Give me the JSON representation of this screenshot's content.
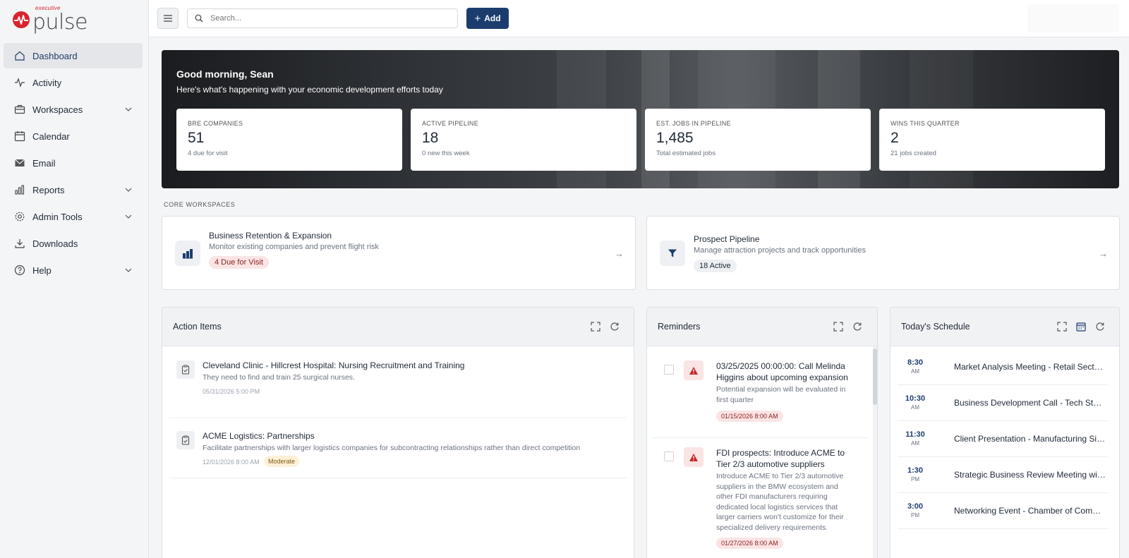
{
  "brand": {
    "small": "executive",
    "big": "pulse",
    "accent": "#d9232d"
  },
  "sidebar": {
    "items": [
      {
        "label": "Dashboard",
        "icon": "home-icon",
        "active": true
      },
      {
        "label": "Activity",
        "icon": "activity-icon"
      },
      {
        "label": "Workspaces",
        "icon": "briefcase-icon",
        "expandable": true
      },
      {
        "label": "Calendar",
        "icon": "calendar-icon"
      },
      {
        "label": "Email",
        "icon": "mail-icon"
      },
      {
        "label": "Reports",
        "icon": "bar-chart-icon",
        "expandable": true
      },
      {
        "label": "Admin Tools",
        "icon": "gear-icon",
        "expandable": true
      },
      {
        "label": "Downloads",
        "icon": "download-icon"
      },
      {
        "label": "Help",
        "icon": "help-icon",
        "expandable": true
      }
    ]
  },
  "topbar": {
    "search_placeholder": "Search...",
    "add_label": "Add",
    "accent": "#1b3d6e"
  },
  "hero": {
    "greeting": "Good morning, Sean",
    "subtitle": "Here's what's happening with your economic development efforts today",
    "stats": [
      {
        "label": "BRE COMPANIES",
        "value": "51",
        "sub": "4 due for visit"
      },
      {
        "label": "ACTIVE PIPELINE",
        "value": "18",
        "sub": "0 new this week"
      },
      {
        "label": "EST. JOBS IN PIPELINE",
        "value": "1,485",
        "sub": "Total estimated jobs"
      },
      {
        "label": "WINS THIS QUARTER",
        "value": "2",
        "sub": "21 jobs created"
      }
    ]
  },
  "core_workspaces": {
    "title": "CORE WORKSPACES",
    "cards": [
      {
        "title": "Business Retention & Expansion",
        "desc": "Monitor existing companies and prevent flight risk",
        "badge": "4 Due for Visit",
        "icon": "buildings-icon"
      },
      {
        "title": "Prospect Pipeline",
        "desc": "Manage attraction projects and track opportunities",
        "badge": "18 Active",
        "icon": "funnel-icon"
      }
    ]
  },
  "action_items": {
    "title": "Action Items",
    "items": [
      {
        "title": "Cleveland Clinic - Hillcrest Hospital: Nursing Recruitment and Training",
        "desc": "They need to find and train 25 surgical nurses.",
        "date": "05/31/2026 5:00 PM",
        "priority": ""
      },
      {
        "title": "ACME Logistics: Partnerships",
        "desc": "Facilitate partnerships with larger logistics companies for subcontracting relationships rather than direct competition",
        "date": "12/01/2026 8:00 AM",
        "priority": "Moderate"
      }
    ]
  },
  "reminders": {
    "title": "Reminders",
    "items": [
      {
        "title": "03/25/2025 00:00:00: Call Melinda Higgins about upcoming expansion",
        "desc": "Potential expansion will be evaluated in first quarter",
        "date": "01/15/2026 8:00 AM"
      },
      {
        "title": "FDI prospects: Introduce ACME to Tier 2/3 automotive suppliers",
        "desc": "Introduce ACME to Tier 2/3 automotive suppliers in the BMW ecosystem and other FDI manufacturers requiring dedicated local logistics services that larger carriers won't customize for their specialized delivery requirements.",
        "date": "01/27/2026 8:00 AM"
      }
    ]
  },
  "schedule": {
    "title": "Today's Schedule",
    "items": [
      {
        "time": "8:30",
        "ampm": "AM",
        "title": "Market Analysis Meeting - Retail Sector Review"
      },
      {
        "time": "10:30",
        "ampm": "AM",
        "title": "Business Development Call - Tech Startup"
      },
      {
        "time": "11:30",
        "ampm": "AM",
        "title": "Client Presentation - Manufacturing Site Selection"
      },
      {
        "time": "1:30",
        "ampm": "PM",
        "title": "Strategic Business Review Meeting with Partners"
      },
      {
        "time": "3:00",
        "ampm": "PM",
        "title": "Networking Event - Chamber of Commerce"
      }
    ]
  }
}
